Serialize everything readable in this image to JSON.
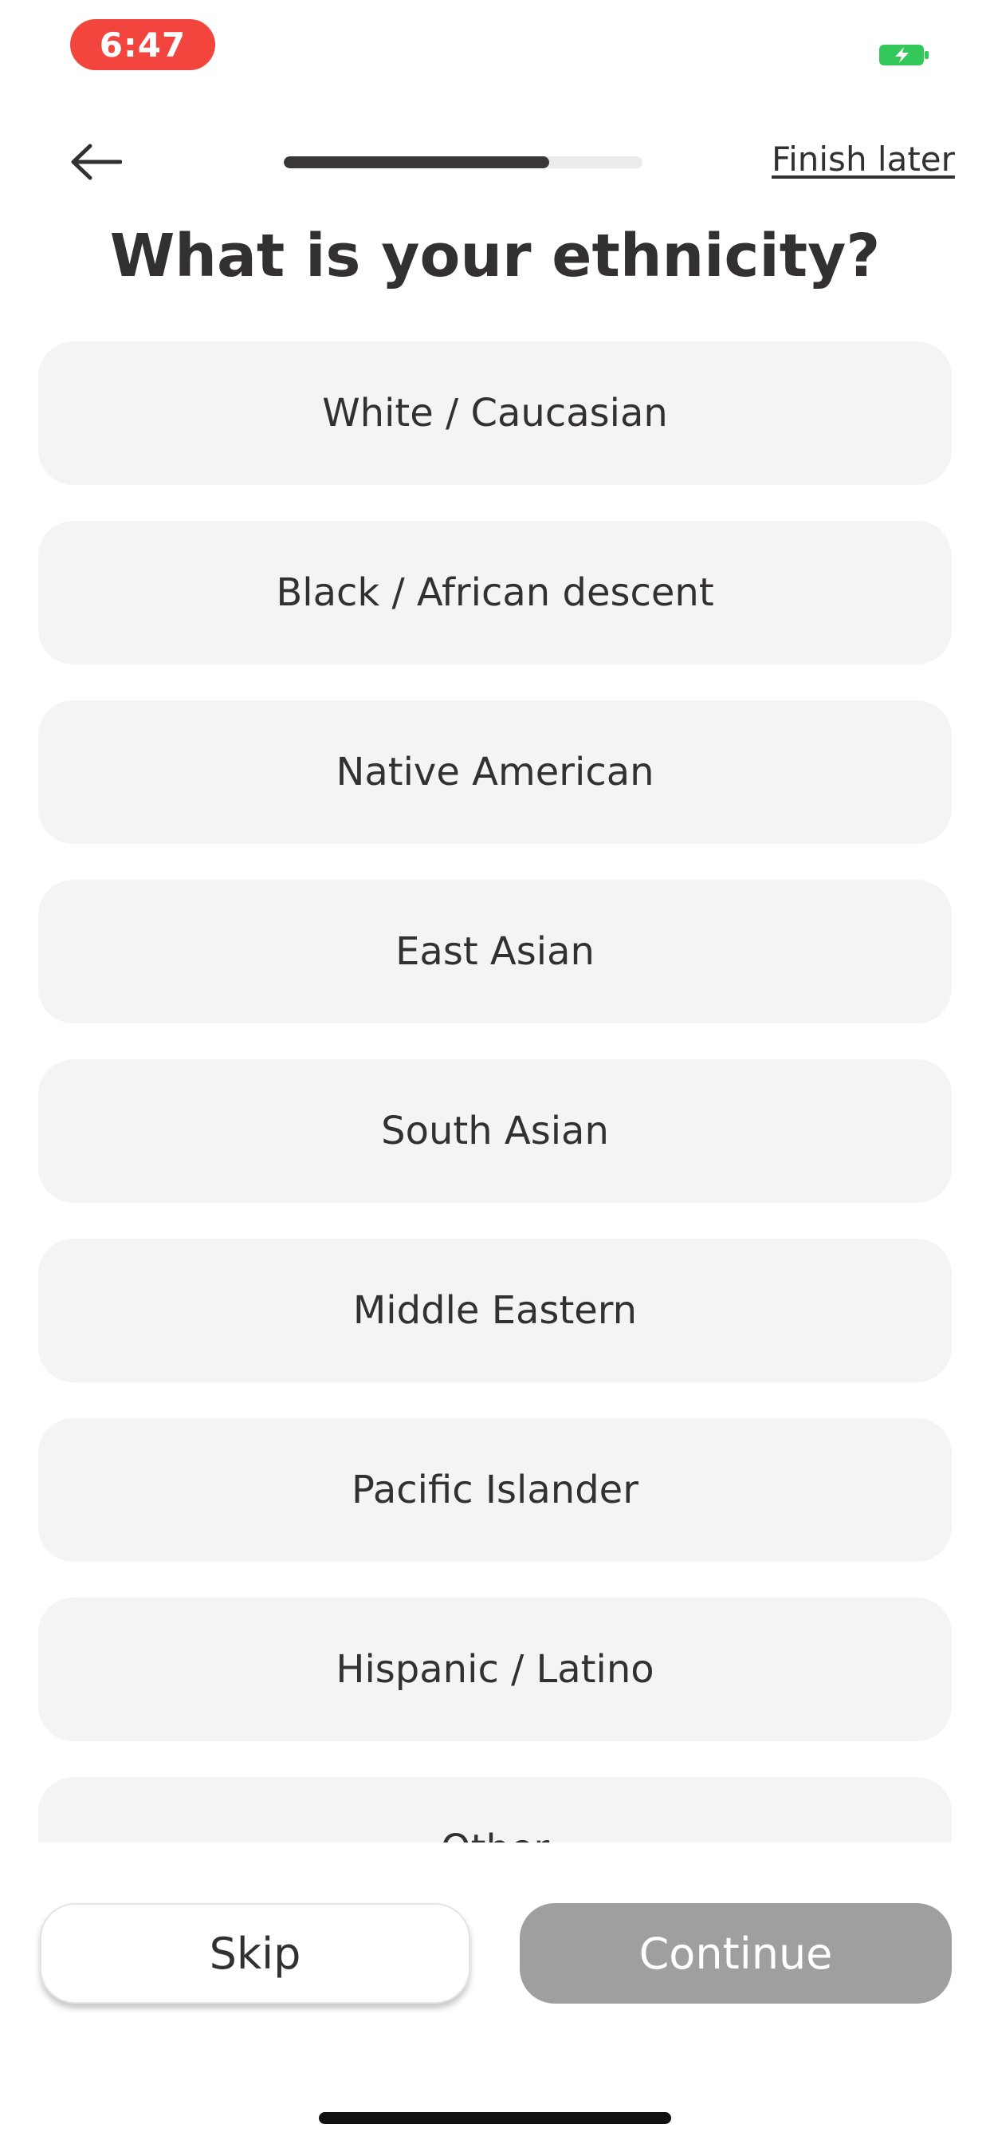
{
  "status_bar": {
    "time": "6:47",
    "time_pill_color": "#f2453d",
    "battery_icon": "battery-charging-icon",
    "battery_color": "#34c759"
  },
  "header": {
    "back_icon": "arrow-left-icon",
    "progress_fraction": 0.74,
    "finish_later_label": "Finish later"
  },
  "question": {
    "title": "What is your ethnicity?"
  },
  "options": [
    {
      "label": "White / Caucasian"
    },
    {
      "label": "Black / African descent"
    },
    {
      "label": "Native American"
    },
    {
      "label": "East Asian"
    },
    {
      "label": "South Asian"
    },
    {
      "label": "Middle Eastern"
    },
    {
      "label": "Pacific Islander"
    },
    {
      "label": "Hispanic / Latino"
    },
    {
      "label": "Other"
    }
  ],
  "footer": {
    "skip_label": "Skip",
    "continue_label": "Continue",
    "continue_enabled": false
  }
}
